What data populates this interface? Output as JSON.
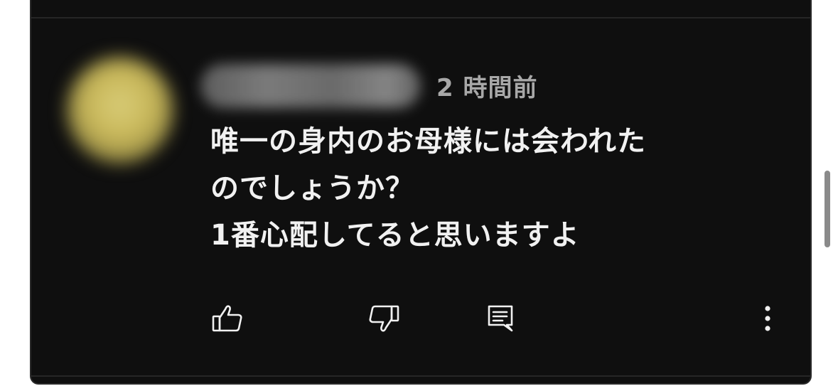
{
  "comment": {
    "timestamp": "2 時間前",
    "lines": [
      "唯一の身内のお母様には会われた",
      "のでしょうか？",
      "1番心配してると思いますよ"
    ]
  },
  "actions": {
    "like_icon": "thumbs-up-icon",
    "dislike_icon": "thumbs-down-icon",
    "reply_icon": "reply-comment-icon",
    "more_icon": "more-vertical-icon"
  },
  "colors": {
    "background": "#0f0f0f",
    "text": "#f1f1f1",
    "secondary_text": "#a8a8a8"
  }
}
